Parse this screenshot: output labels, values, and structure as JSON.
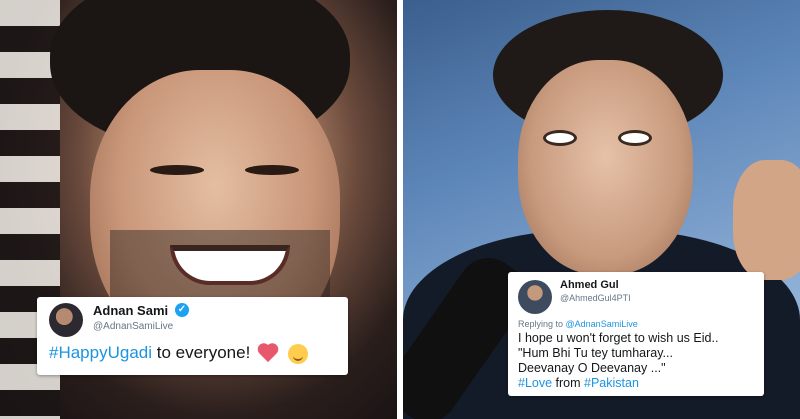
{
  "left_tweet": {
    "name": "Adnan Sami",
    "handle": "@AdnanSamiLive",
    "hashtag": "#HappyUgadi",
    "text": " to everyone!",
    "emojis": [
      "heart-icon",
      "smiling-face-icon"
    ]
  },
  "right_tweet": {
    "name": "Ahmed Gul",
    "handle": "@AhmedGul4PTI",
    "reply_prefix": "Replying to ",
    "reply_to": "@AdnanSamiLive",
    "line1": "I hope u won't  forget to wish us Eid..",
    "line2": "\"Hum Bhi Tu tey tumharay...",
    "line3": "Deevanay O Deevanay ...\"",
    "tag_love": "#Love",
    "from_word": " from ",
    "tag_pakistan": "#Pakistan"
  },
  "colors": {
    "hashtag": "#1b95e0",
    "verified": "#1da1f2",
    "handle": "#657786"
  }
}
